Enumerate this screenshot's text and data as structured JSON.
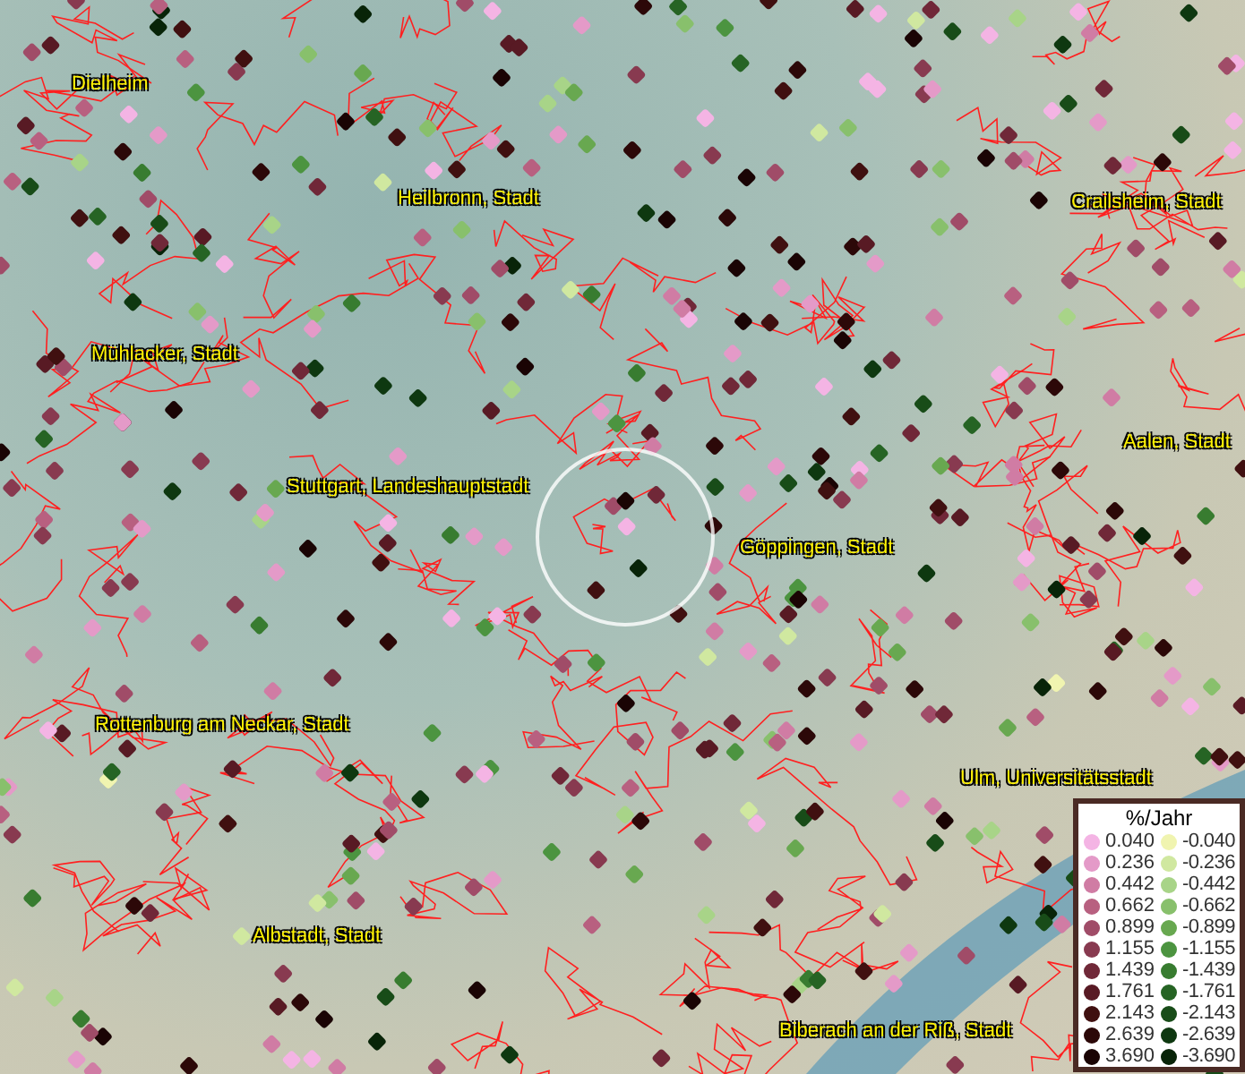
{
  "map": {
    "places": [
      {
        "name": "Dielheim"
      },
      {
        "name": "Heilbronn, Stadt"
      },
      {
        "name": "Crailsheim, Stadt"
      },
      {
        "name": "Mühlacker, Stadt"
      },
      {
        "name": "Aalen, Stadt"
      },
      {
        "name": "Stuttgart, Landeshauptstadt"
      },
      {
        "name": "Göppingen, Stadt"
      },
      {
        "name": "Rottenburg am Neckar, Stadt"
      },
      {
        "name": "Ulm, Universitätsstadt"
      },
      {
        "name": "Albstadt, Stadt"
      },
      {
        "name": "Biberach an der Riß, Stadt"
      }
    ]
  },
  "legend": {
    "title": "%/Jahr",
    "positive": [
      {
        "label": "0.040",
        "color": "#f4b4e4"
      },
      {
        "label": "0.236",
        "color": "#e49ac8"
      },
      {
        "label": "0.442",
        "color": "#d07ca4"
      },
      {
        "label": "0.662",
        "color": "#b86080"
      },
      {
        "label": "0.899",
        "color": "#a04c68"
      },
      {
        "label": "1.155",
        "color": "#883a50"
      },
      {
        "label": "1.439",
        "color": "#702838"
      },
      {
        "label": "1.761",
        "color": "#581a24"
      },
      {
        "label": "2.143",
        "color": "#401010"
      },
      {
        "label": "2.639",
        "color": "#2c0808"
      },
      {
        "label": "3.690",
        "color": "#1a0404"
      }
    ],
    "negative": [
      {
        "label": "-0.040",
        "color": "#f0f4b0"
      },
      {
        "label": "-0.236",
        "color": "#d0e8a0"
      },
      {
        "label": "-0.442",
        "color": "#a8d488"
      },
      {
        "label": "-0.662",
        "color": "#88c06c"
      },
      {
        "label": "-0.899",
        "color": "#68a850"
      },
      {
        "label": "-1.155",
        "color": "#4c9440"
      },
      {
        "label": "-1.439",
        "color": "#387c30"
      },
      {
        "label": "-1.761",
        "color": "#266424"
      },
      {
        "label": "-2.143",
        "color": "#184c18"
      },
      {
        "label": "-2.639",
        "color": "#0e3810"
      },
      {
        "label": "-3.690",
        "color": "#082408"
      }
    ]
  }
}
